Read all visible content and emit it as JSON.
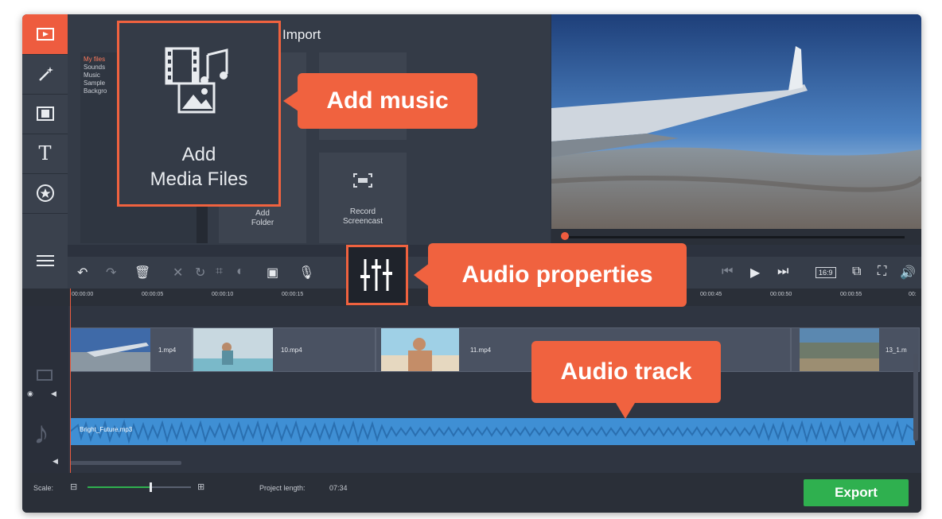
{
  "import": {
    "title": "Import",
    "files": [
      "My files",
      "Sounds",
      "Music",
      "Sample",
      "Backgro"
    ],
    "add_media_label_1": "Add",
    "add_media_label_2": "Media Files",
    "add_folder_1": "Add",
    "add_folder_2": "Folder",
    "record_1": "Record",
    "record_2": "Screencast"
  },
  "toolbar": {
    "aspect": "16:9"
  },
  "ruler": {
    "ticks": [
      "00:00:00",
      "00:00:05",
      "00:00:10",
      "00:00:15",
      "00:00:45",
      "00:00:50",
      "00:00:55",
      "00:"
    ]
  },
  "clips": [
    {
      "name": "1.mp4"
    },
    {
      "name": "10.mp4"
    },
    {
      "name": "11.mp4"
    },
    {
      "name": "13_1.m"
    }
  ],
  "audio": {
    "file": "Bright_Future.mp3"
  },
  "bottom": {
    "scale_label": "Scale:",
    "project_length_label": "Project length:",
    "project_length": "07:34",
    "export_label": "Export"
  },
  "callouts": {
    "add_music": "Add music",
    "audio_properties": "Audio properties",
    "audio_track": "Audio track"
  },
  "colors": {
    "accent": "#f0623f",
    "export": "#2fb04f",
    "audio": "#3f8fd4"
  }
}
